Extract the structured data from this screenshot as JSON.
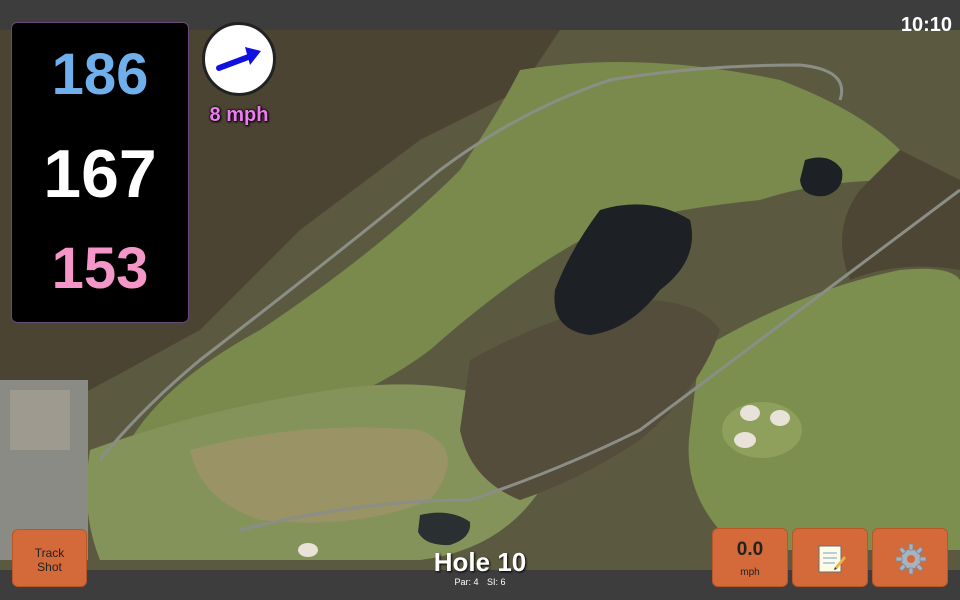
{
  "status": {
    "time": "10:10"
  },
  "distances": {
    "back": "186",
    "middle": "167",
    "front": "153"
  },
  "wind": {
    "speed": "8 mph",
    "direction_icon": "arrow-right-icon",
    "arrow_color": "#1010e0"
  },
  "hole": {
    "title": "Hole 10",
    "par": "Par: 4",
    "stroke_index": "SI: 6"
  },
  "buttons": {
    "track_shot": "Track\nShot",
    "speed_value": "0.0",
    "speed_unit": "mph",
    "notes_icon": "notepad-icon",
    "settings_icon": "gear-icon"
  },
  "colors": {
    "back": "#6fb0ec",
    "middle": "#ffffff",
    "front": "#f497c8",
    "button": "#d4693a",
    "wind_text": "#ee7bf2"
  }
}
